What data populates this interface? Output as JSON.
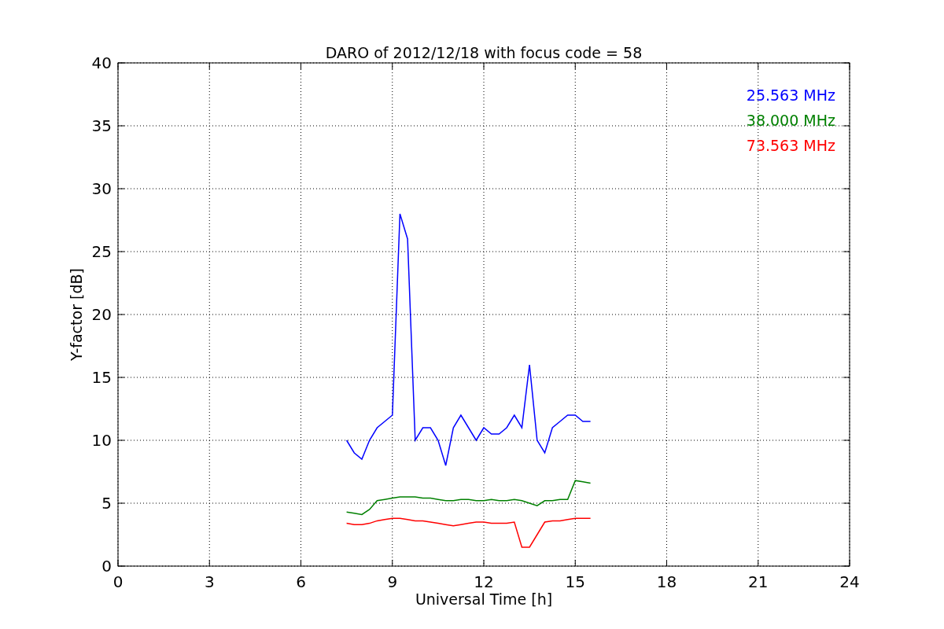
{
  "chart_data": {
    "type": "line",
    "title": "DARO of 2012/12/18 with focus code = 58",
    "xlabel": "Universal Time [h]",
    "ylabel": "Y-factor [dB]",
    "x": [
      7.5,
      7.75,
      8.0,
      8.25,
      8.5,
      8.75,
      9.0,
      9.25,
      9.5,
      9.75,
      10.0,
      10.25,
      10.5,
      10.75,
      11.0,
      11.25,
      11.5,
      11.75,
      12.0,
      12.25,
      12.5,
      12.75,
      13.0,
      13.25,
      13.5,
      13.75,
      14.0,
      14.25,
      14.5,
      14.75,
      15.0,
      15.25,
      15.5
    ],
    "series": [
      {
        "name": "25.563 MHz",
        "color": "#0000ff",
        "values": [
          10,
          9,
          8.5,
          10,
          11,
          11.5,
          12,
          28,
          26,
          10,
          11,
          11,
          10,
          8,
          11,
          12,
          11,
          10,
          11,
          10.5,
          10.5,
          11,
          12,
          11,
          16,
          10,
          9,
          11,
          11.5,
          12,
          12,
          11.5,
          11.5
        ]
      },
      {
        "name": "38.000 MHz",
        "color": "#008000",
        "values": [
          4.3,
          4.2,
          4.1,
          4.5,
          5.2,
          5.3,
          5.4,
          5.5,
          5.5,
          5.5,
          5.4,
          5.4,
          5.3,
          5.2,
          5.2,
          5.3,
          5.3,
          5.2,
          5.2,
          5.3,
          5.2,
          5.2,
          5.3,
          5.2,
          5.0,
          4.8,
          5.2,
          5.2,
          5.3,
          5.3,
          6.8,
          6.7,
          6.6
        ]
      },
      {
        "name": "73.563 MHz",
        "color": "#ff0000",
        "values": [
          3.4,
          3.3,
          3.3,
          3.4,
          3.6,
          3.7,
          3.8,
          3.8,
          3.7,
          3.6,
          3.6,
          3.5,
          3.4,
          3.3,
          3.2,
          3.3,
          3.4,
          3.5,
          3.5,
          3.4,
          3.4,
          3.4,
          3.5,
          1.5,
          1.5,
          2.5,
          3.5,
          3.6,
          3.6,
          3.7,
          3.8,
          3.8,
          3.8
        ]
      }
    ],
    "xlim": [
      0,
      24
    ],
    "ylim": [
      0,
      40
    ],
    "xticks": [
      0,
      3,
      6,
      9,
      12,
      15,
      18,
      21,
      24
    ],
    "yticks": [
      0,
      5,
      10,
      15,
      20,
      25,
      30,
      35,
      40
    ],
    "grid": true
  }
}
